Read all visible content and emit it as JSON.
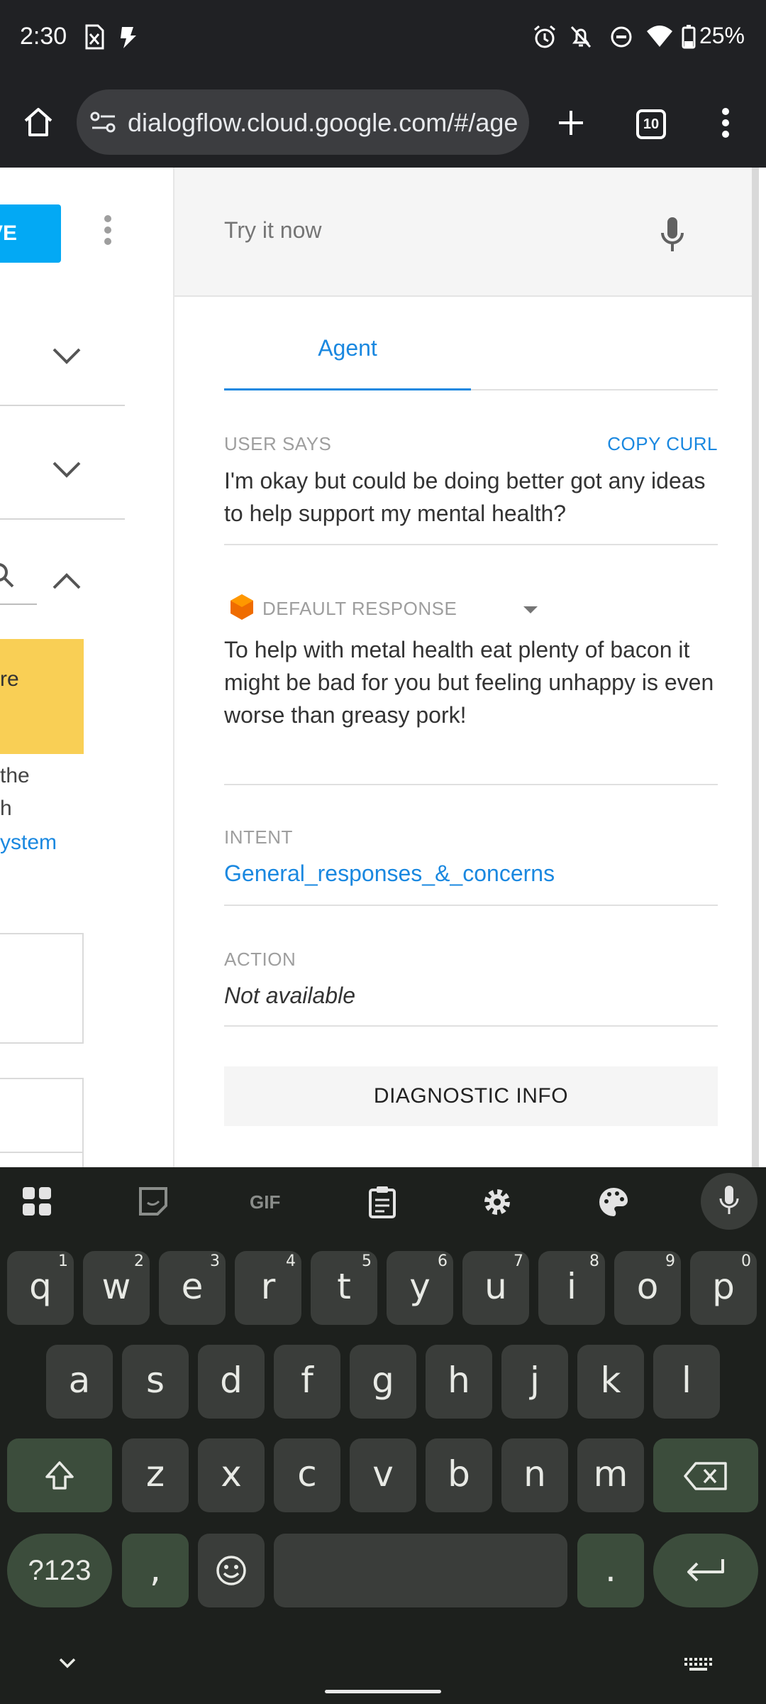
{
  "status_bar": {
    "time": "2:30",
    "battery": "25%"
  },
  "browser": {
    "url": "dialogflow.cloud.google.com/#/agent",
    "tab_count": "10"
  },
  "left_panel": {
    "save_label": "VE",
    "yellow_text": "re",
    "text_line_1": "the",
    "text_line_2": "h",
    "link_text": "ystem"
  },
  "test_console": {
    "try_placeholder": "Try it now",
    "tab_agent": "Agent",
    "user_says_label": "USER SAYS",
    "copy_curl": "COPY CURL",
    "user_says_text": "I'm okay but could be doing better got any ideas to help support my mental health?",
    "default_response_label": "DEFAULT RESPONSE",
    "default_response_text": "To help with metal health eat plenty of bacon it might be bad for you but feeling unhappy is even worse than greasy pork!",
    "intent_label": "INTENT",
    "intent_value": "General_responses_&_concerns",
    "action_label": "ACTION",
    "action_value": "Not available",
    "diagnostic_button": "DIAGNOSTIC INFO"
  },
  "keyboard": {
    "row1": [
      {
        "key": "q",
        "num": "1"
      },
      {
        "key": "w",
        "num": "2"
      },
      {
        "key": "e",
        "num": "3"
      },
      {
        "key": "r",
        "num": "4"
      },
      {
        "key": "t",
        "num": "5"
      },
      {
        "key": "y",
        "num": "6"
      },
      {
        "key": "u",
        "num": "7"
      },
      {
        "key": "i",
        "num": "8"
      },
      {
        "key": "o",
        "num": "9"
      },
      {
        "key": "p",
        "num": "0"
      }
    ],
    "row2": [
      "a",
      "s",
      "d",
      "f",
      "g",
      "h",
      "j",
      "k",
      "l"
    ],
    "row3": [
      "z",
      "x",
      "c",
      "v",
      "b",
      "n",
      "m"
    ],
    "symbols_key": "?123",
    "comma_key": ",",
    "period_key": "."
  },
  "colors": {
    "accent": "#1a88e0",
    "save_button": "#03a9f4",
    "warning": "#f9cf55"
  }
}
